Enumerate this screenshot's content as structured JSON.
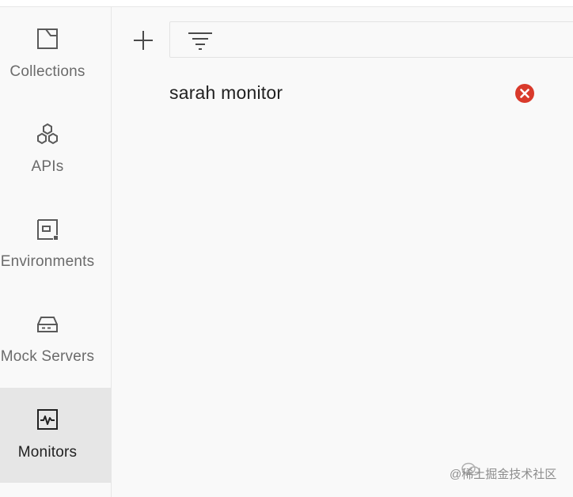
{
  "sidebar": {
    "items": [
      {
        "label": "Collections",
        "icon": "collections-icon"
      },
      {
        "label": "APIs",
        "icon": "apis-icon"
      },
      {
        "label": "Environments",
        "icon": "environments-icon"
      },
      {
        "label": "Mock Servers",
        "icon": "mock-servers-icon"
      },
      {
        "label": "Monitors",
        "icon": "monitors-icon",
        "selected": true
      }
    ]
  },
  "toolbar": {
    "add_icon": "plus-icon",
    "filter_icon": "filter-icon",
    "search_value": ""
  },
  "monitors": [
    {
      "name": "sarah monitor",
      "status_icon": "error-icon",
      "status_color": "#d93a2b"
    }
  ],
  "watermark": {
    "text": "@稀土掘金技术社区"
  },
  "colors": {
    "selected_bg": "#e6e6e6",
    "error": "#d93a2b"
  }
}
